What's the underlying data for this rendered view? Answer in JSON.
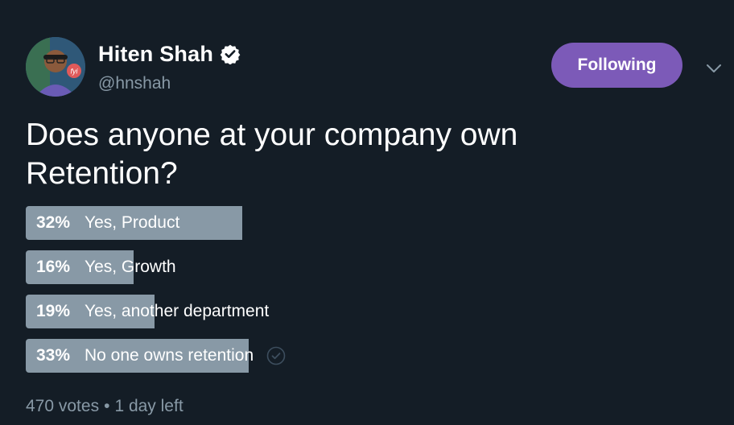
{
  "user": {
    "display_name": "Hiten Shah",
    "handle": "@hnshah",
    "verified": true,
    "avatar_badge": "fyi"
  },
  "follow_button": {
    "label": "Following",
    "color": "#7c5ab8"
  },
  "menu_icon": "chevron-down-icon",
  "tweet": {
    "text": "Does anyone at your company own Retention?"
  },
  "poll": {
    "options": [
      {
        "percent_label": "32%",
        "label": "Yes, Product",
        "fraction": 0.32
      },
      {
        "percent_label": "16%",
        "label": "Yes, Growth",
        "fraction": 0.16
      },
      {
        "percent_label": "19%",
        "label": "Yes, another department",
        "fraction": 0.19
      },
      {
        "percent_label": "33%",
        "label": "No one owns retention",
        "fraction": 0.33,
        "user_voted": true
      }
    ],
    "votes": "470 votes",
    "separator": "•",
    "time_left": "1 day left"
  },
  "colors": {
    "background": "#141d26",
    "bar": "#8899a6",
    "muted_text": "#8899a6"
  }
}
